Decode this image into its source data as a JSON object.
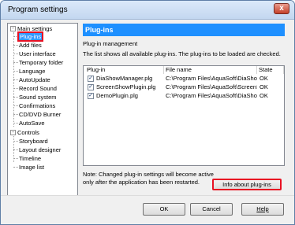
{
  "window": {
    "title": "Program settings",
    "close_label": "x"
  },
  "tree": {
    "groups": [
      {
        "label": "Main settings",
        "expander": "-"
      },
      {
        "label": "Controls",
        "expander": "-"
      }
    ],
    "main_items": [
      "Plug-ins",
      "Add files",
      "User interface",
      "Temporary folder",
      "Language",
      "AutoUpdate",
      "Record Sound",
      "Sound system",
      "Confirmations",
      "CD/DVD Burner",
      "AutoSave"
    ],
    "control_items": [
      "Storyboard",
      "Layout designer",
      "Timeline",
      "Image list"
    ]
  },
  "panel": {
    "header": "Plug-ins",
    "section_title": "Plug-in management",
    "description": "The list shows all available plug-ins. The plug-ins to be loaded are checked."
  },
  "plugin_table": {
    "columns": [
      "Plug-in",
      "File name",
      "State"
    ],
    "rows": [
      {
        "checked": "✓",
        "name": "DiaShowManager.plg",
        "file": "C:\\Program Files\\AquaSoft\\DiaShow ...",
        "state": "OK"
      },
      {
        "checked": "✓",
        "name": "ScreenShowPlugin.plg",
        "file": "C:\\Program Files\\AquaSoft\\ScreenS...",
        "state": "OK"
      },
      {
        "checked": "✓",
        "name": "DemoPlugin.plg",
        "file": "C:\\Program Files\\AquaSoft\\DiaShow ...",
        "state": "OK"
      }
    ]
  },
  "note": "Note: Changed plug-in settings will become active only after the application has been restarted.",
  "buttons": {
    "info": "Info about plug-ins",
    "ok": "OK",
    "cancel": "Cancel",
    "help": "Help"
  },
  "colors": {
    "header_blue": "#1e90ff",
    "highlight_red": "#e81123",
    "selection_blue": "#3399ff"
  }
}
